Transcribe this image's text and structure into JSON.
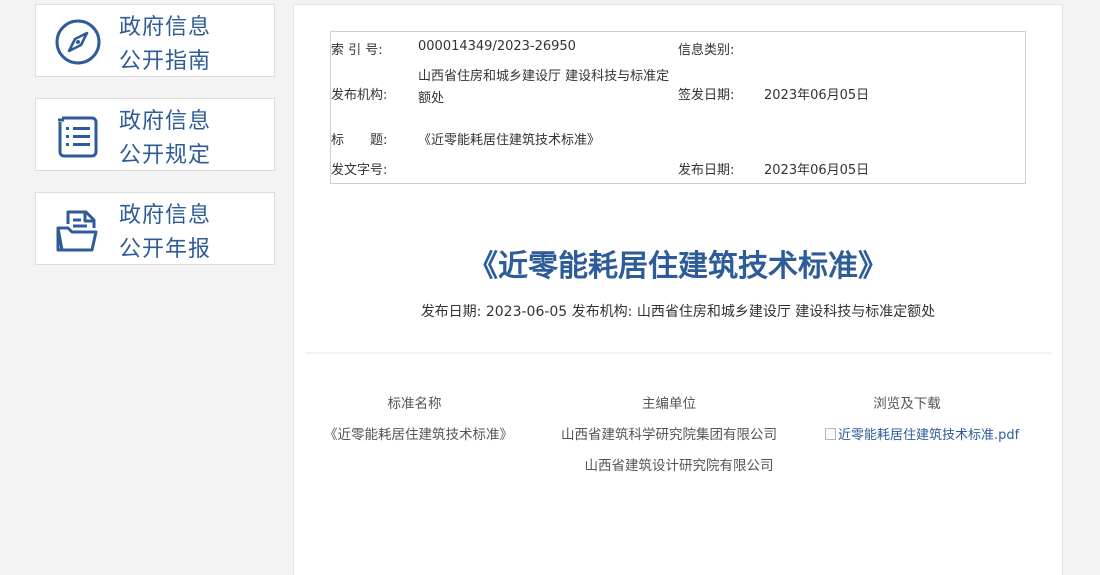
{
  "sidebar": {
    "items": [
      {
        "line1": "政府信息",
        "line2": "公开指南",
        "icon": "compass-icon"
      },
      {
        "line1": "政府信息",
        "line2": "公开规定",
        "icon": "document-list-icon"
      },
      {
        "line1": "政府信息",
        "line2": "公开年报",
        "icon": "open-folder-icon"
      }
    ]
  },
  "meta": {
    "index_label": "索 引 号:",
    "index_value": "000014349/2023-26950",
    "category_label": "信息类别:",
    "category_value": "",
    "org_label": "发布机构:",
    "org_value": "山西省住房和城乡建设厅 建设科技与标准定额处",
    "sign_date_label": "签发日期:",
    "sign_date_value": "2023年06月05日",
    "title_label": "标　　题:",
    "title_value": "《近零能耗居住建筑技术标准》",
    "doc_no_label": "发文字号:",
    "doc_no_value": "",
    "publish_date_label": "发布日期:",
    "publish_date_value": "2023年06月05日"
  },
  "article": {
    "title": "《近零能耗居住建筑技术标准》",
    "subtitle": "发布日期: 2023-06-05 发布机构: 山西省住房和城乡建设厅 建设科技与标准定额处"
  },
  "table": {
    "headers": [
      "标准名称",
      "主编单位",
      "浏览及下载"
    ],
    "standard_name": "《近零能耗居住建筑技术标准》",
    "editors": [
      "山西省建筑科学研究院集团有限公司",
      "山西省建筑设计研究院有限公司"
    ],
    "download_link": "近零能耗居住建筑技术标准.pdf"
  },
  "colors": {
    "accent": "#2e5c98",
    "background": "#f3f3f3"
  }
}
